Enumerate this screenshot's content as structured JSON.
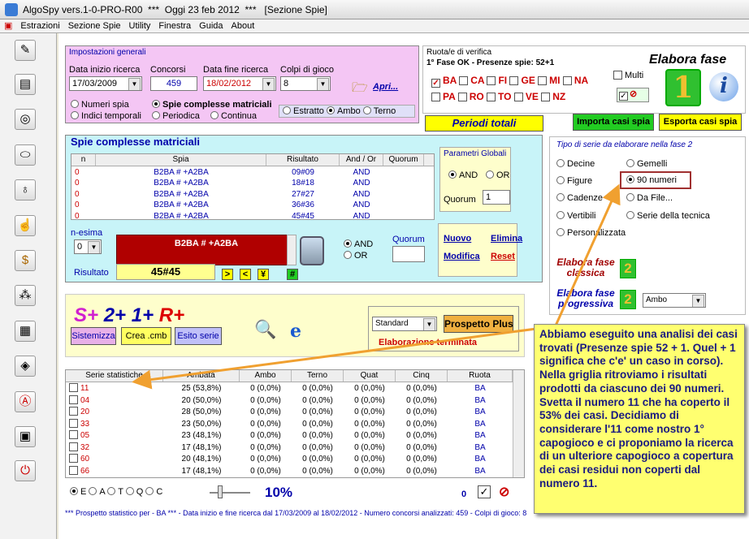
{
  "window": {
    "title": "AlgoSpy vers.1-0-PRO-R00  ***  Oggi 23 feb 2012  ***   [Sezione Spie]"
  },
  "menu": [
    "Estrazioni",
    "Sezione Spie",
    "Utility",
    "Finestra",
    "Guida",
    "About"
  ],
  "toolbar_icons": [
    "pencil-icon",
    "book-icon",
    "compass-icon",
    "pills-icon",
    "bulb-icon",
    "hand-icon",
    "dollar-icon",
    "balls-icon",
    "calendar-icon",
    "drop-icon",
    "letter-a-icon",
    "terminal-icon",
    "power-icon"
  ],
  "impostazioni": {
    "title": "Impostazioni generali",
    "data_inizio_label": "Data inizio ricerca",
    "data_inizio": "17/03/2009",
    "concorsi_label": "Concorsi",
    "concorsi": "459",
    "data_fine_label": "Data fine ricerca",
    "data_fine": "18/02/2012",
    "colpi_label": "Colpi di gioco",
    "colpi": "8",
    "apri": "Apri...",
    "opt_numeri_spia": "Numeri spia",
    "opt_spie_complesse": "Spie complesse matriciali",
    "opt_indici": "Indici temporali",
    "opt_periodica": "Periodica",
    "opt_continua": "Continua",
    "opt_estratto": "Estratto",
    "opt_ambo": "Ambo",
    "opt_terno": "Terno"
  },
  "ruote": {
    "title": "Ruota/e di verifica",
    "fase": "1° Fase OK - Presenze spie: 52+1",
    "row1": [
      "BA",
      "CA",
      "FI",
      "GE",
      "MI",
      "NA"
    ],
    "row2": [
      "PA",
      "RO",
      "TO",
      "VE",
      "NZ"
    ],
    "multi": "Multi"
  },
  "elabora": {
    "title": "Elabora fase",
    "badge": "1",
    "info": "i"
  },
  "periodi": "Periodi totali",
  "importa": "Importa casi spia",
  "esporta": "Esporta casi spia",
  "spie": {
    "title": "Spie complesse matriciali",
    "headers": [
      "n",
      "Spia",
      "Risultato",
      "And / Or",
      "Quorum"
    ],
    "rows": [
      [
        "0",
        "B2BA # +A2BA",
        "09#09",
        "AND",
        ""
      ],
      [
        "0",
        "B2BA # +A2BA",
        "18#18",
        "AND",
        ""
      ],
      [
        "0",
        "B2BA # +A2BA",
        "27#27",
        "AND",
        ""
      ],
      [
        "0",
        "B2BA # +A2BA",
        "36#36",
        "AND",
        ""
      ],
      [
        "0",
        "B2BA # +A2BA",
        "45#45",
        "AND",
        ""
      ]
    ],
    "params_title": "Parametri Globali",
    "and": "AND",
    "or": "OR",
    "quorum_label": "Quorum",
    "quorum": "1",
    "nesima_label": "n-esima",
    "nesima": "0",
    "formula": "B2BA # +A2BA",
    "risultato_label": "Risultato",
    "risultato": "45#45",
    "sym1": ">",
    "sym2": "<",
    "sym3": "¥",
    "sym4": "#",
    "and2": "AND",
    "or2": "OR",
    "quorum2_label": "Quorum",
    "nuovo": "Nuovo",
    "elimina": "Elimina",
    "modifica": "Modifica",
    "reset": "Reset"
  },
  "tipo": {
    "title": "Tipo di serie da elaborare nella fase 2",
    "opts": [
      [
        "Decine",
        "Gemelli"
      ],
      [
        "Figure",
        "90 numeri"
      ],
      [
        "Cadenze",
        "Da File..."
      ],
      [
        "Vertibili",
        "Serie della tecnica"
      ],
      [
        "Personalizzata",
        ""
      ]
    ],
    "classica": "Elabora fase\nclassica",
    "progressiva": "Elabora fase\nprogressiva",
    "badge": "2",
    "sel": "Ambo"
  },
  "splus": {
    "s": "S+",
    "two": "2+",
    "one": "1+",
    "r": "R+",
    "sistemizza": "Sistemizza",
    "crea": "Crea .cmb",
    "esito": "Esito serie",
    "standard": "Standard",
    "prospetto": "Prospetto Plus",
    "status": "Elaborazione terminata"
  },
  "stats": {
    "headers": [
      "Serie statistiche",
      "Ambata",
      "Ambo",
      "Terno",
      "Quat",
      "Cinq",
      "Ruota"
    ],
    "rows": [
      [
        "11",
        "25 (53,8%)",
        "0 (0,0%)",
        "0 (0,0%)",
        "0 (0,0%)",
        "0 (0,0%)",
        "BA"
      ],
      [
        "04",
        "20 (50,0%)",
        "0 (0,0%)",
        "0 (0,0%)",
        "0 (0,0%)",
        "0 (0,0%)",
        "BA"
      ],
      [
        "20",
        "28 (50,0%)",
        "0 (0,0%)",
        "0 (0,0%)",
        "0 (0,0%)",
        "0 (0,0%)",
        "BA"
      ],
      [
        "33",
        "23 (50,0%)",
        "0 (0,0%)",
        "0 (0,0%)",
        "0 (0,0%)",
        "0 (0,0%)",
        "BA"
      ],
      [
        "05",
        "23 (48,1%)",
        "0 (0,0%)",
        "0 (0,0%)",
        "0 (0,0%)",
        "0 (0,0%)",
        "BA"
      ],
      [
        "32",
        "17 (48,1%)",
        "0 (0,0%)",
        "0 (0,0%)",
        "0 (0,0%)",
        "0 (0,0%)",
        "BA"
      ],
      [
        "60",
        "20 (48,1%)",
        "0 (0,0%)",
        "0 (0,0%)",
        "0 (0,0%)",
        "0 (0,0%)",
        "BA"
      ],
      [
        "66",
        "17 (48,1%)",
        "0 (0,0%)",
        "0 (0,0%)",
        "0 (0,0%)",
        "0 (0,0%)",
        "BA"
      ]
    ]
  },
  "bottom": {
    "opts": [
      "E",
      "A",
      "T",
      "Q",
      "C"
    ],
    "percent": "10%",
    "zero": "0",
    "status": "*** Prospetto statistico per  - BA ***  - Data inizio e fine ricerca dal 17/03/2009 al 18/02/2012 - Numero concorsi analizzati: 459 - Colpi di gioco: 8"
  },
  "callout": "Abbiamo eseguito una analisi dei casi trovati (Presenze spie 52 + 1. Quel + 1 significa che c'e' un caso in corso). Nella griglia ritroviamo i risultati prodotti da ciascuno dei 90 numeri. Svetta il numero 11 che ha coperto il 53% dei casi. Decidiamo di considerare l'11 come nostro 1° capogioco e ci proponiamo la ricerca di un ulteriore capogioco a copertura dei casi residui non coperti dal numero 11.",
  "colors": {
    "pink": "#f4c6f4",
    "cyan": "#c8f4f8",
    "accent_red": "#b00000",
    "green": "#22cc22",
    "yellow": "#ffff00",
    "orange": "#f0a030"
  }
}
